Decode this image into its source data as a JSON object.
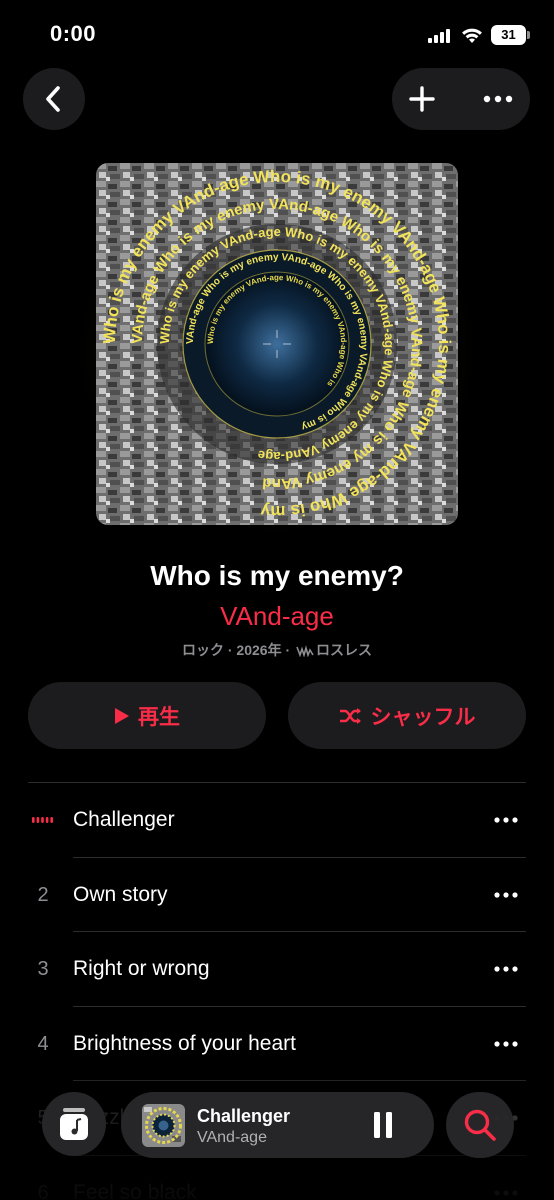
{
  "status_bar": {
    "time": "0:00",
    "battery": "31"
  },
  "header": {
    "back_icon": "chevron-left-icon",
    "add_icon": "plus-icon",
    "more_icon": "ellipsis-icon"
  },
  "artwork": {
    "ring_text_1": "Who is my enemy",
    "ring_text_2": "VAnd-age"
  },
  "album": {
    "title": "Who is my enemy?",
    "artist": "VAnd-age",
    "meta_prefix": "ロック · 2026年 · ",
    "meta_suffix": "ロスレス"
  },
  "buttons": {
    "play_label": "再生",
    "shuffle_label": "シャッフル"
  },
  "tracks": [
    {
      "number": "",
      "title": "Challenger",
      "playing": true
    },
    {
      "number": "2",
      "title": "Own story"
    },
    {
      "number": "3",
      "title": "Right or wrong"
    },
    {
      "number": "4",
      "title": "Brightness of your heart"
    },
    {
      "number": "5",
      "title": "Puzzle"
    },
    {
      "number": "6",
      "title": "Feel so black"
    }
  ],
  "mini_player": {
    "title": "Challenger",
    "artist": "VAnd-age"
  },
  "colors": {
    "accent": "#fa2d48",
    "background": "#000000",
    "surface": "#1c1c1e",
    "secondary_text": "#8e8e93"
  }
}
